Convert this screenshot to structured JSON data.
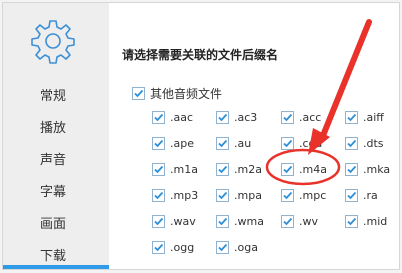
{
  "sidebar": {
    "items": [
      {
        "label": "常规"
      },
      {
        "label": "播放"
      },
      {
        "label": "声音"
      },
      {
        "label": "字幕"
      },
      {
        "label": "画面"
      },
      {
        "label": "下载"
      }
    ]
  },
  "main": {
    "section_title": "请选择需要关联的文件后缀名",
    "other_audio_label": "其他音频文件",
    "extensions": [
      ".aac",
      ".ac3",
      ".acc",
      ".aiff",
      ".ape",
      ".au",
      ".cda",
      ".dts",
      ".m1a",
      ".m2a",
      ".m4a",
      ".mka",
      ".mp3",
      ".mpa",
      ".mpc",
      ".ra",
      ".wav",
      ".wma",
      ".wv",
      ".mid",
      ".ogg",
      ".oga"
    ]
  },
  "annotation": {
    "color": "#e8322a",
    "highlighted_extension": ".m4a"
  },
  "colors": {
    "accent": "#2f9be8",
    "check": "#2b8fd8"
  }
}
